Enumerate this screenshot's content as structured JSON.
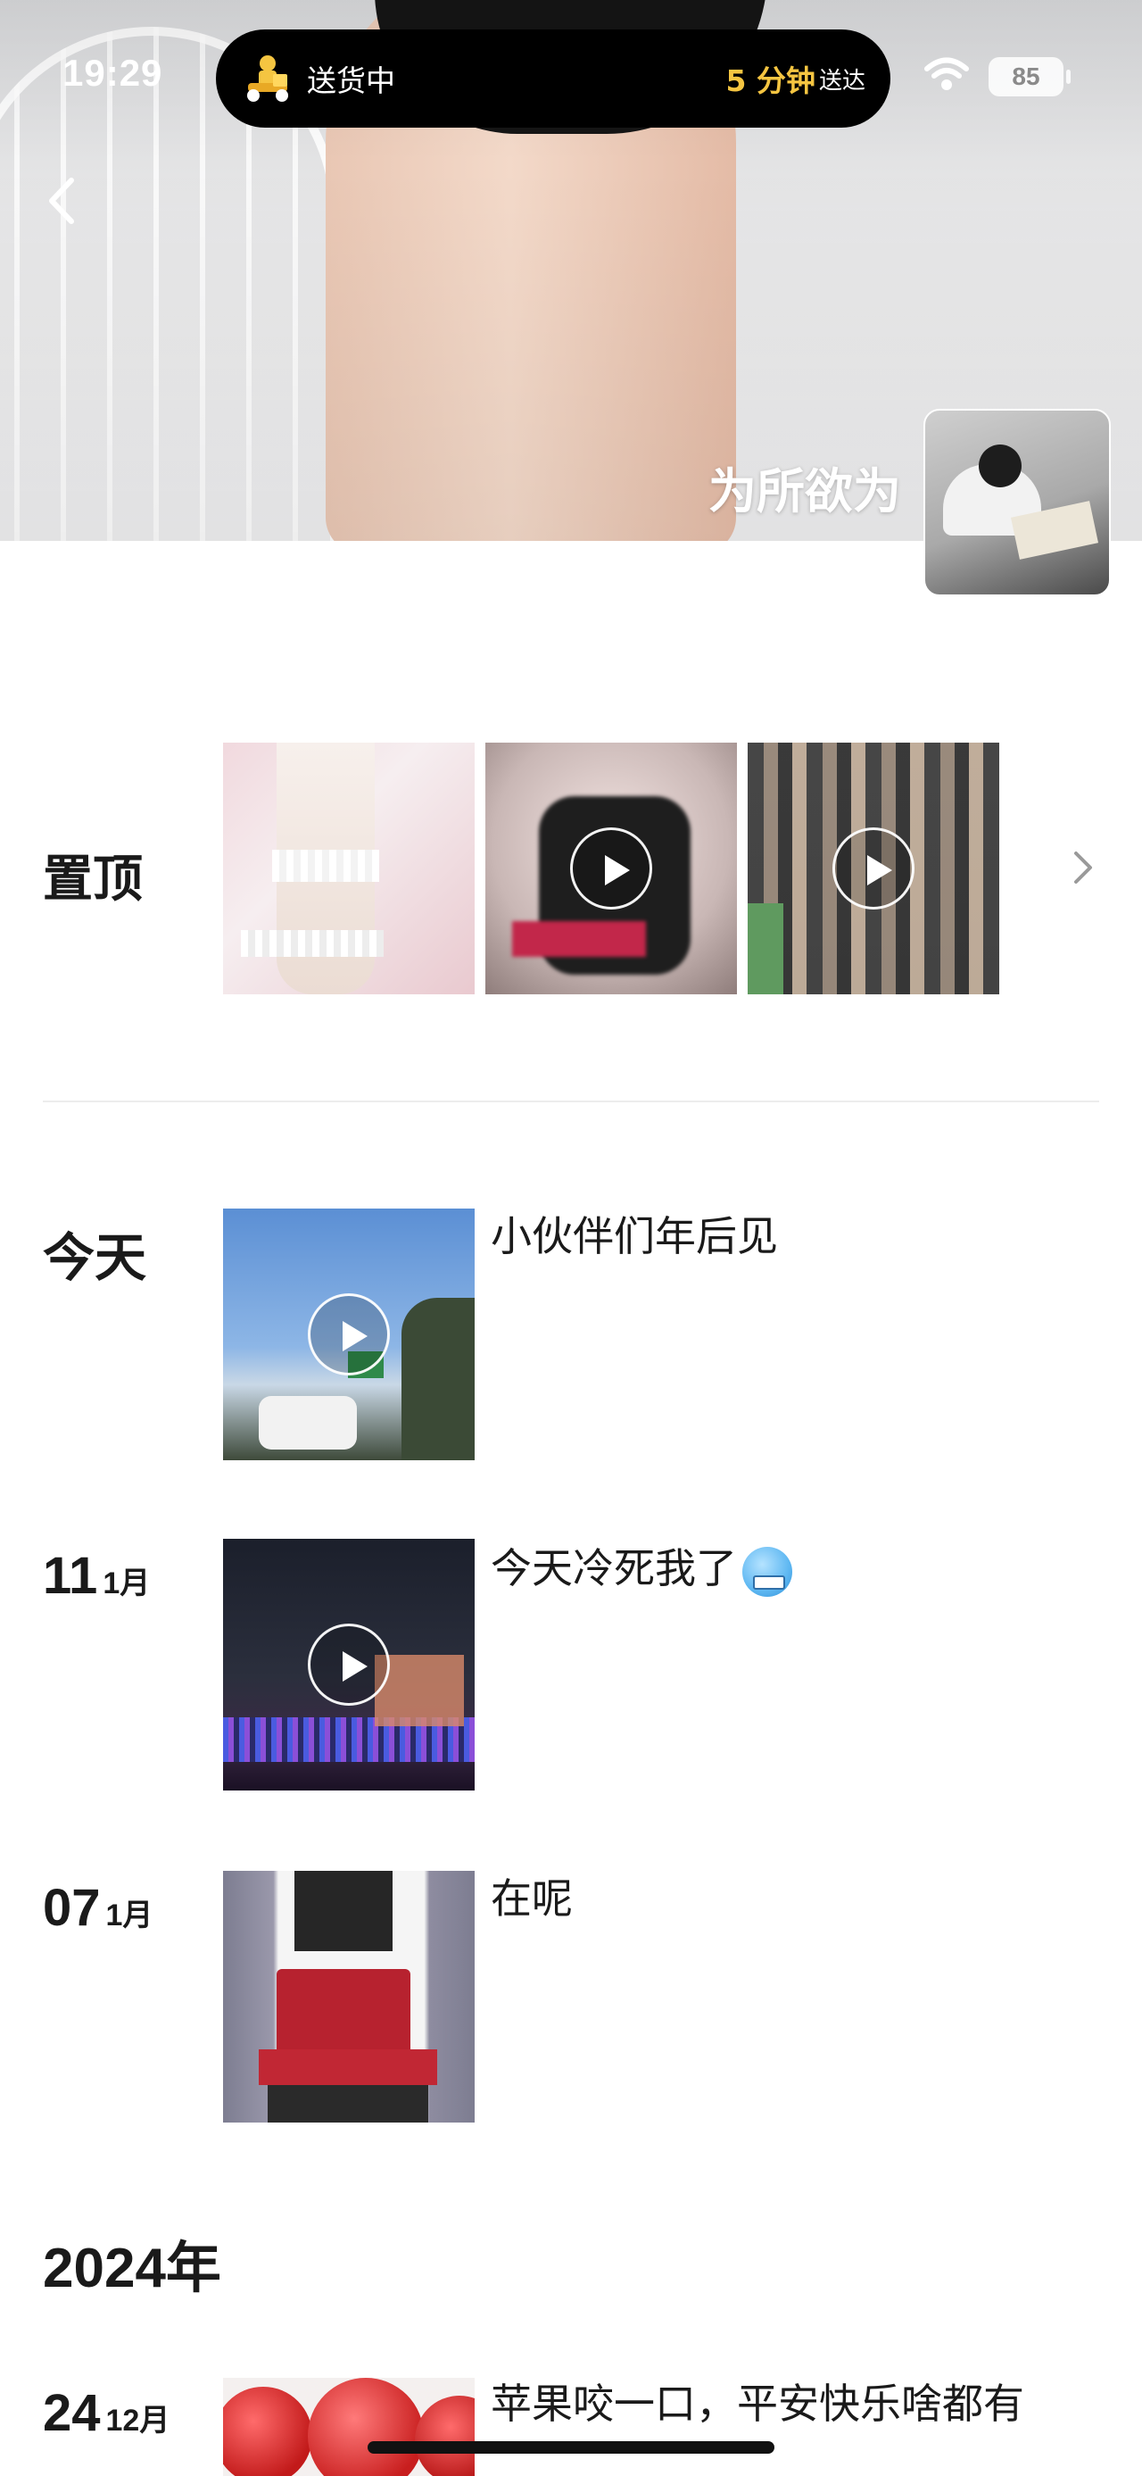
{
  "status_bar": {
    "time": "19:29",
    "activity": "送货中",
    "eta_value": "5 分钟",
    "eta_unit": "送达",
    "battery": "85"
  },
  "profile": {
    "nickname": "为所欲为"
  },
  "pinned": {
    "label": "置顶",
    "items": [
      {
        "type": "photo"
      },
      {
        "type": "video"
      },
      {
        "type": "video"
      }
    ]
  },
  "feed": [
    {
      "date_big": "今天",
      "date_small": "",
      "text": "小伙伴们年后见",
      "type": "video"
    },
    {
      "date_big": "11",
      "date_small": "1月",
      "text": "今天冷死我了",
      "type": "video",
      "emoji": "freezing-face-emoji"
    },
    {
      "date_big": "07",
      "date_small": "1月",
      "text": "在呢",
      "type": "photo"
    }
  ],
  "year_label": "2024年",
  "feed_2024": [
    {
      "date_big": "24",
      "date_small": "12月",
      "text": "苹果咬一口，平安快乐啥都有",
      "type": "photo"
    }
  ],
  "icons": {
    "back": "chevron-left-icon",
    "more": "chevron-right-icon",
    "play": "play-icon",
    "wifi": "wifi-icon",
    "delivery": "delivery-rider-icon"
  },
  "colors": {
    "eta_accent": "#f5c541",
    "island_bg": "#000000",
    "text_primary": "#1a1a1a"
  }
}
